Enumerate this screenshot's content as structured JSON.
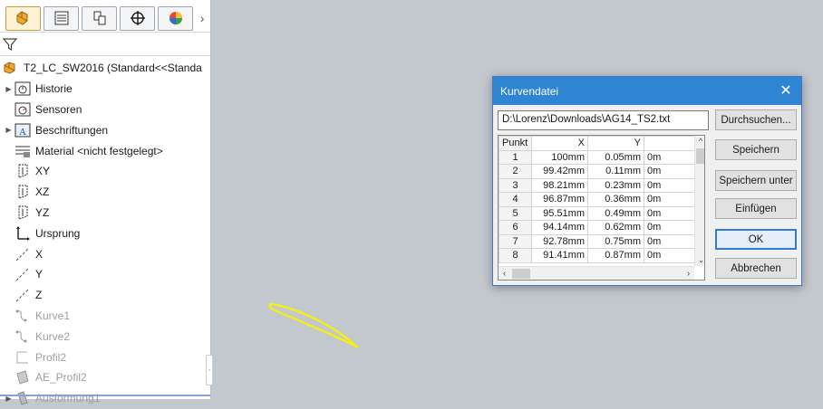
{
  "feature_tree": {
    "tabs": [
      {
        "icon": "feature-manager-icon"
      },
      {
        "icon": "property-manager-icon"
      },
      {
        "icon": "configuration-manager-icon"
      },
      {
        "icon": "dimxpert-icon"
      },
      {
        "icon": "display-manager-icon"
      }
    ],
    "root": "T2_LC_SW2016  (Standard<<Standa",
    "items": [
      {
        "label": "Historie",
        "icon": "history-icon",
        "expandable": true
      },
      {
        "label": "Sensoren",
        "icon": "sensor-icon",
        "expandable": false
      },
      {
        "label": "Beschriftungen",
        "icon": "annotations-icon",
        "expandable": true
      },
      {
        "label": "Material <nicht festgelegt>",
        "icon": "material-icon",
        "expandable": false
      },
      {
        "label": "XY",
        "icon": "plane-icon",
        "expandable": false
      },
      {
        "label": "XZ",
        "icon": "plane-icon",
        "expandable": false
      },
      {
        "label": "YZ",
        "icon": "plane-icon",
        "expandable": false
      },
      {
        "label": "Ursprung",
        "icon": "origin-icon",
        "expandable": false
      },
      {
        "label": "X",
        "icon": "axis-icon",
        "expandable": false
      },
      {
        "label": "Y",
        "icon": "axis-icon",
        "expandable": false
      },
      {
        "label": "Z",
        "icon": "axis-icon",
        "expandable": false
      },
      {
        "label": "Kurve1",
        "icon": "curve-icon",
        "expandable": false
      },
      {
        "label": "Kurve2",
        "icon": "curve-icon",
        "expandable": false
      },
      {
        "label": "Profil2",
        "icon": "sketch-icon",
        "expandable": false
      },
      {
        "label": "AE_Profil2",
        "icon": "surface-icon",
        "expandable": false
      },
      {
        "label": "Ausformung1",
        "icon": "loft-icon",
        "expandable": true
      }
    ]
  },
  "dialog": {
    "title": "Kurvendatei",
    "path": "D:\\Lorenz\\Downloads\\AG14_TS2.txt",
    "buttons": {
      "browse": "Durchsuchen...",
      "save": "Speichern",
      "save_as": "Speichern unter",
      "insert": "Einfügen",
      "ok": "OK",
      "cancel": "Abbrechen"
    },
    "columns": [
      "Punkt",
      "X",
      "Y",
      ""
    ],
    "rows": [
      [
        "1",
        "100mm",
        "0.05mm",
        "0m"
      ],
      [
        "2",
        "99.42mm",
        "0.11mm",
        "0m"
      ],
      [
        "3",
        "98.21mm",
        "0.23mm",
        "0m"
      ],
      [
        "4",
        "96.87mm",
        "0.36mm",
        "0m"
      ],
      [
        "5",
        "95.51mm",
        "0.49mm",
        "0m"
      ],
      [
        "6",
        "94.14mm",
        "0.62mm",
        "0m"
      ],
      [
        "7",
        "92.78mm",
        "0.75mm",
        "0m"
      ],
      [
        "8",
        "91.41mm",
        "0.87mm",
        "0m"
      ]
    ]
  },
  "colors": {
    "viewport": "#c3c7ce",
    "title_bar": "#2f84d4",
    "curve": "#f2ee1c"
  }
}
